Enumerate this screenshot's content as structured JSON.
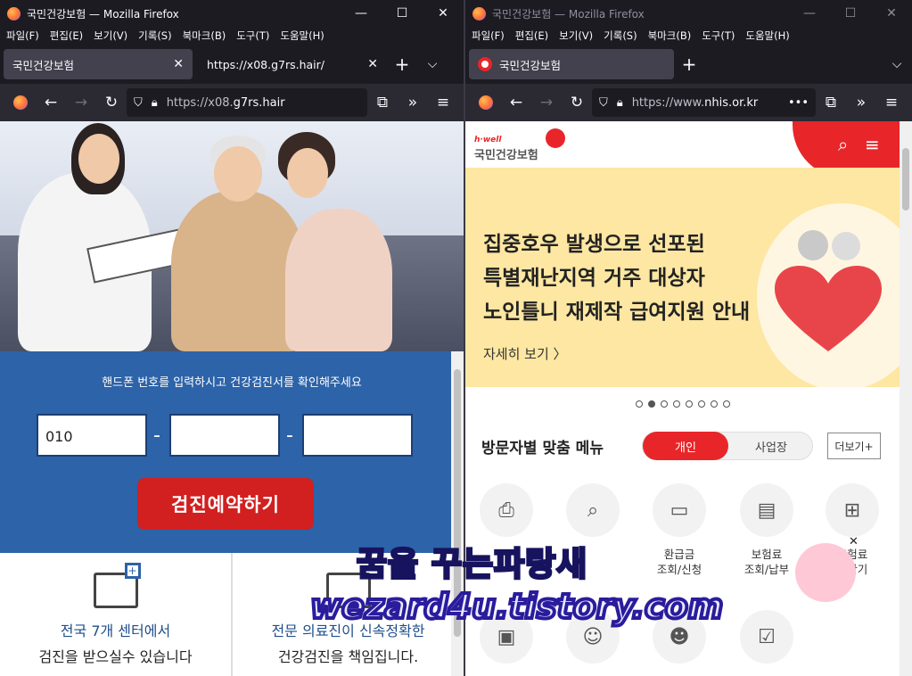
{
  "left_window": {
    "title": "국민건강보험 — Mozilla Firefox",
    "menu": [
      "파일(F)",
      "편집(E)",
      "보기(V)",
      "기록(S)",
      "북마크(B)",
      "도구(T)",
      "도움말(H)"
    ],
    "tabs": [
      {
        "label": "국민건강보험",
        "active": true
      },
      {
        "label": "https://x08.g7rs.hair/",
        "active": false
      }
    ],
    "url_prefix": "https://x08.",
    "url_host": "g7rs.hair",
    "page": {
      "instruction": "핸드폰 번호를 입력하시고 건강검진서를 확인해주세요",
      "phone_fields": [
        "010",
        "",
        ""
      ],
      "dash": "-",
      "book_button": "검진예약하기",
      "info": [
        {
          "line1": "전국 7개 센터에서",
          "line2": "검진을 받으실수 있습니다"
        },
        {
          "line1": "전문 의료진이 신속정확한",
          "line2": "건강검진을 책임집니다."
        }
      ]
    }
  },
  "right_window": {
    "title": "국민건강보험 — Mozilla Firefox",
    "menu": [
      "파일(F)",
      "편집(E)",
      "보기(V)",
      "기록(S)",
      "북마크(B)",
      "도구(T)",
      "도움말(H)"
    ],
    "tabs": [
      {
        "label": "국민건강보험",
        "active": true
      }
    ],
    "url_prefix": "https://www.",
    "url_host": "nhis.or.kr",
    "page": {
      "logo_sub": "h·well",
      "logo_name": "국민건강보험",
      "banner": {
        "lines": [
          "집중호우 발생으로 선포된",
          "특별재난지역 거주 대상자",
          "노인틀니 재제작 급여지원 안내"
        ],
        "more": "자세히 보기  〉"
      },
      "carousel_active_index": 1,
      "carousel_count": 8,
      "menu_title": "방문자별 맞춤 메뉴",
      "toggle_on": "개인",
      "toggle_off": "사업장",
      "more_button": "더보기+",
      "icons_row1": [
        {
          "name": "person-card-icon",
          "label": ""
        },
        {
          "name": "search-doc-icon",
          "label": ""
        },
        {
          "name": "monitor-won-icon",
          "label": "환급금\n조회/신청"
        },
        {
          "name": "receipt-icon",
          "label": "보험료\n조회/납부"
        },
        {
          "name": "calc-icon",
          "label": "보험료\n계산기"
        }
      ],
      "icons_row1_partial_labels": [
        "보험료\n계산기"
      ],
      "icons_row2": [
        {
          "name": "wallet-icon"
        },
        {
          "name": "people-icon"
        },
        {
          "name": "group-icon"
        },
        {
          "name": "checklist-icon"
        }
      ]
    }
  },
  "watermark": {
    "line1": "꿈을 꾸는파랑새",
    "line2": "wezard4u.tistory.com"
  },
  "colors": {
    "firefox_dark": "#1c1b22",
    "nhis_red": "#e8262a",
    "phishing_blue": "#2d63a8",
    "banner_yellow": "#fde7a2"
  }
}
